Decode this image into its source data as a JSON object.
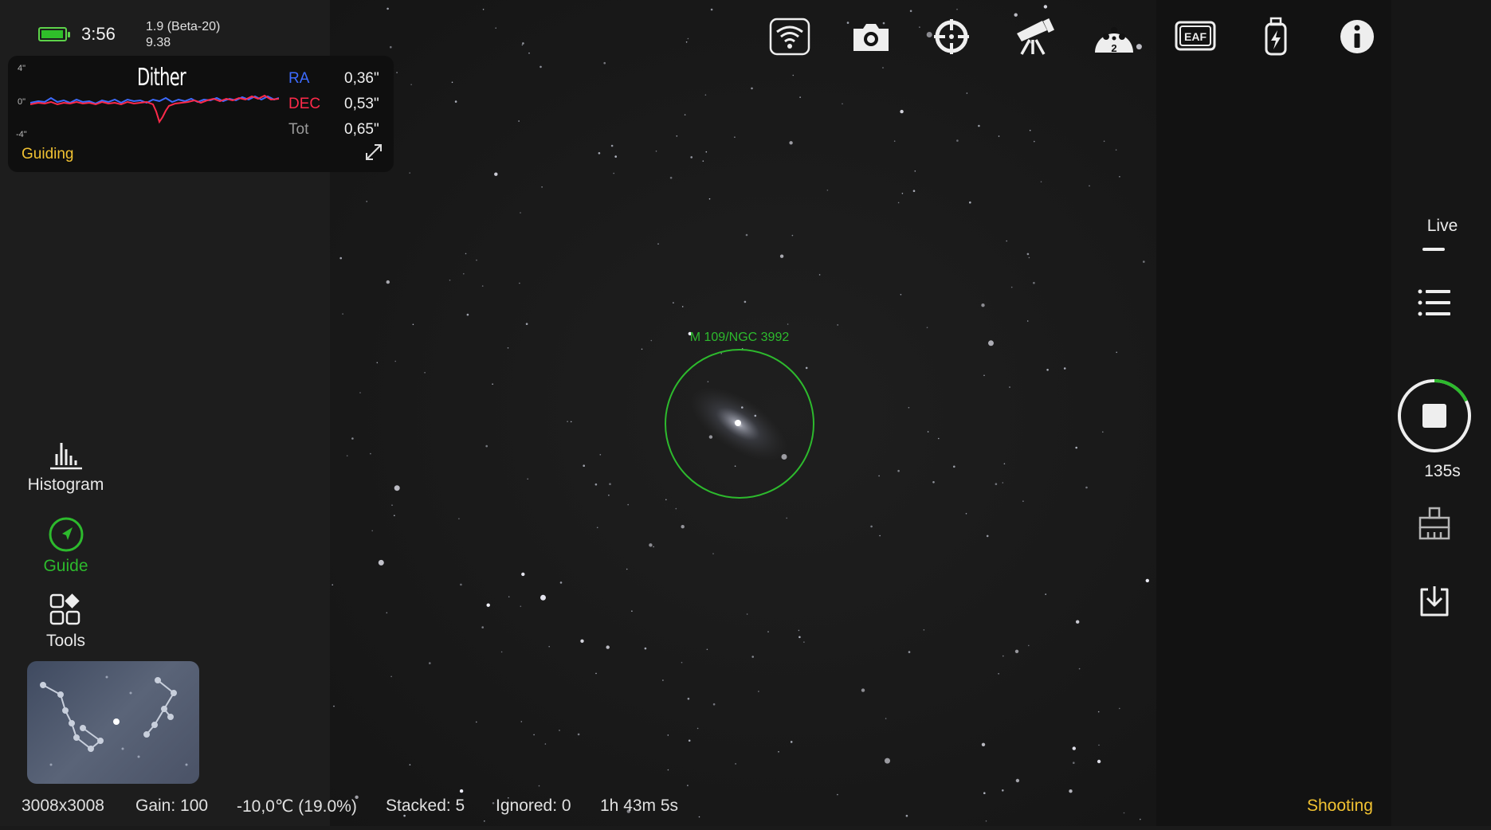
{
  "status": {
    "battery_level": 0.9,
    "clock": "3:56",
    "version_line1": "1.9 (Beta-20)",
    "version_line2": "9.38"
  },
  "guide_graph": {
    "title": "Dither",
    "axis_top": "4\"",
    "axis_zero": "0\"",
    "axis_bottom": "-4\"",
    "ra_label": "RA",
    "ra_value": "0,36\"",
    "dec_label": "DEC",
    "dec_value": "0,53\"",
    "tot_label": "Tot",
    "tot_value": "0,65\"",
    "status": "Guiding",
    "colors": {
      "ra": "#3d6bff",
      "dec": "#ff2a4a",
      "status": "#f1c232"
    }
  },
  "left_tools": [
    {
      "label": "Histogram",
      "icon": "histogram-icon"
    },
    {
      "label": "Guide",
      "icon": "guide-icon",
      "active": true
    },
    {
      "label": "Tools",
      "icon": "tools-icon"
    }
  ],
  "top_toolbar": [
    {
      "icon": "wifi-icon"
    },
    {
      "icon": "camera-icon"
    },
    {
      "icon": "crosshair-icon"
    },
    {
      "icon": "telescope-icon"
    },
    {
      "icon": "filter-wheel-icon",
      "badge": "2"
    },
    {
      "icon": "eaf-icon",
      "label": "EAF"
    },
    {
      "icon": "power-icon"
    },
    {
      "icon": "info-icon"
    }
  ],
  "sky_view": {
    "target_label": "M 109/NGC 3992",
    "target_color": "#2dba2d"
  },
  "right_controls": {
    "live_label": "Live",
    "exposure_label": "135s",
    "exposure_progress": 0.18,
    "accent": "#2dba2d"
  },
  "status_bar": {
    "resolution": "3008x3008",
    "gain": "Gain: 100",
    "temperature": "-10,0℃  (19.0%)",
    "stacked": "Stacked: 5",
    "ignored": "Ignored: 0",
    "duration": "1h 43m 5s",
    "mode": "Shooting"
  }
}
